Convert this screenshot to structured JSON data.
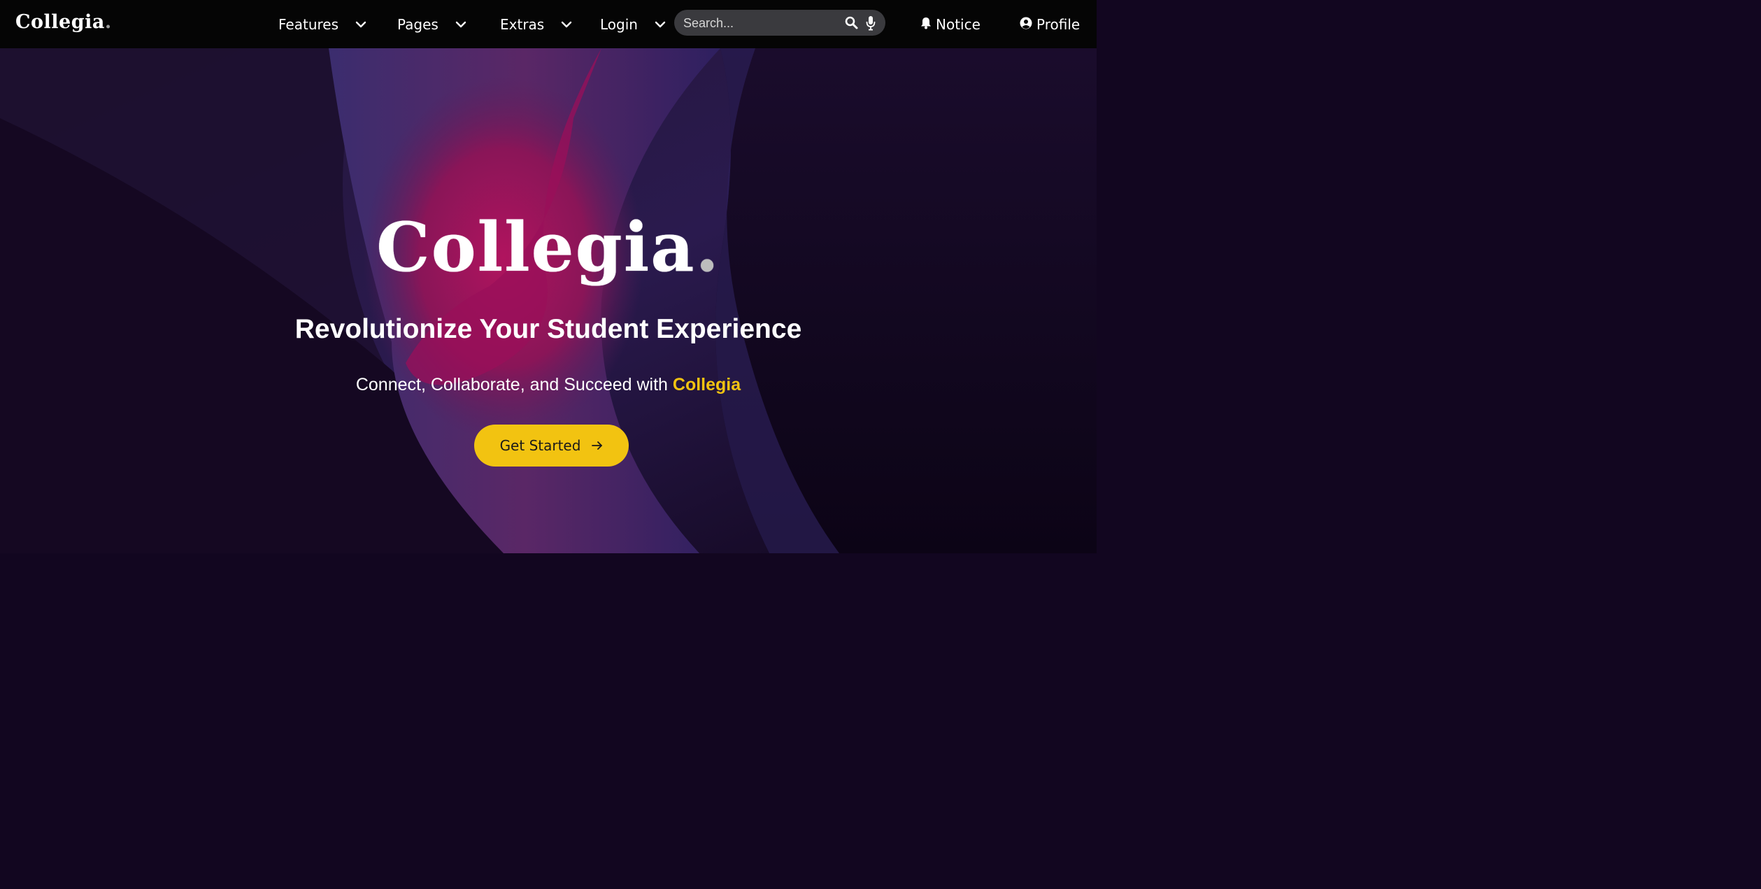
{
  "navbar": {
    "brand": "Collegia",
    "brand_dot": ".",
    "items": [
      {
        "label": "Features",
        "icon": "chevron-down-icon"
      },
      {
        "label": "Pages",
        "icon": "chevron-down-icon"
      },
      {
        "label": "Extras",
        "icon": "chevron-down-icon"
      },
      {
        "label": "Login",
        "icon": "chevron-down-icon"
      }
    ],
    "search": {
      "placeholder": "Search...",
      "value": "",
      "icons": [
        "search-icon",
        "mic-icon"
      ]
    },
    "notice_label": "Notice",
    "profile_label": "Profile"
  },
  "hero": {
    "logo_text": "Collegia",
    "logo_dot": ".",
    "headline": "Revolutionize Your Student Experience",
    "subline_prefix": "Connect, Collaborate, and Succeed with ",
    "subline_accent": "Collegia",
    "cta_label": "Get Started",
    "cta_icon": "arrow-right-icon"
  },
  "colors": {
    "navbar_bg": "#050505",
    "accent": "#f2c311",
    "hero_bg": "#14071f",
    "magenta": "#a0105a",
    "indigo": "#3a2a6a"
  }
}
